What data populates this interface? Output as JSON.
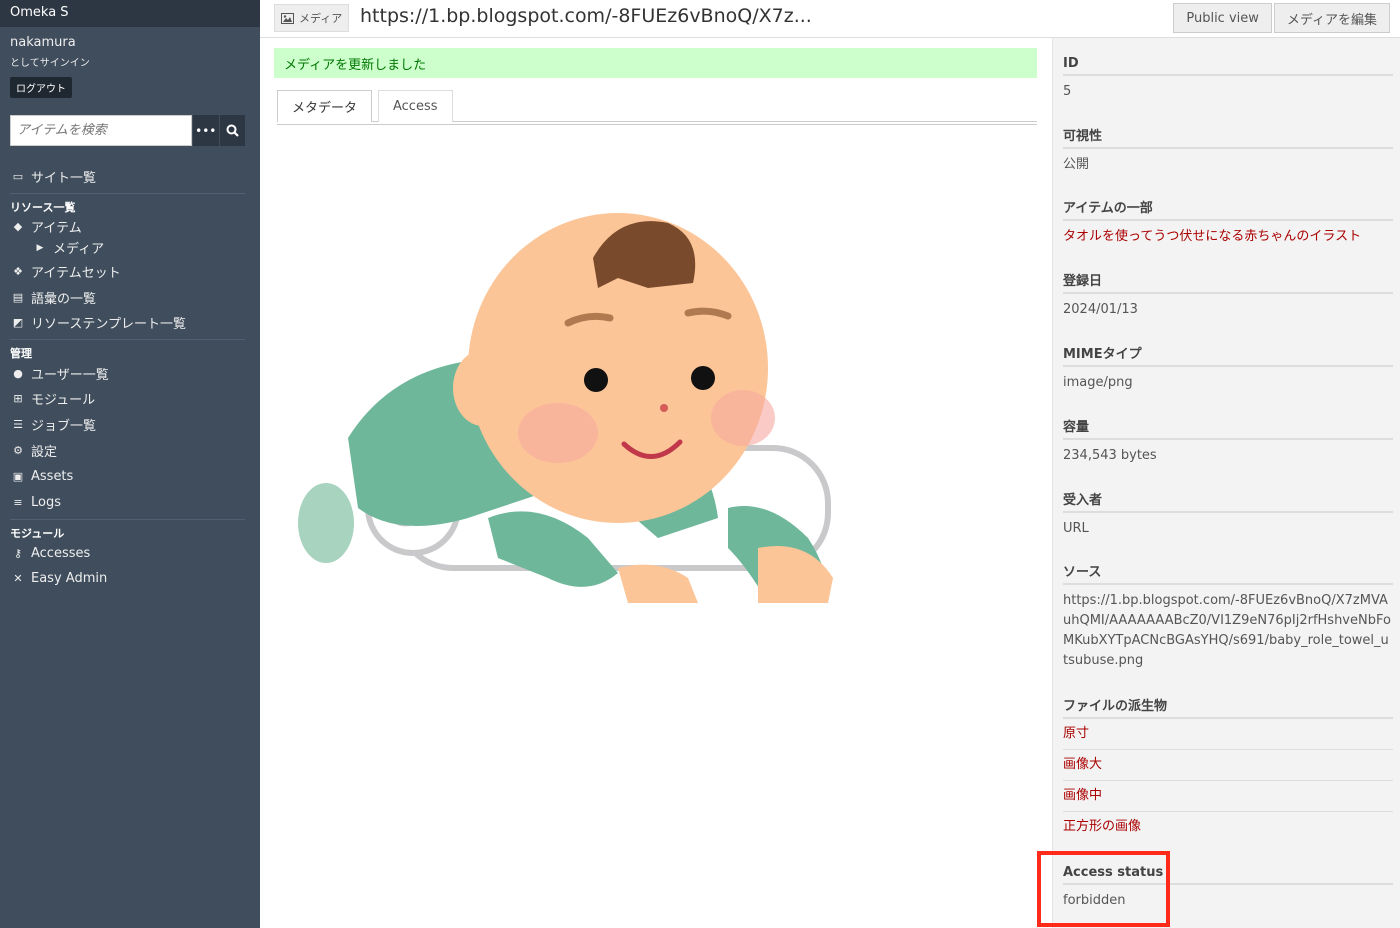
{
  "brand": "Omeka S",
  "user": {
    "name": "nakamura",
    "signed_in_as": "としてサインイン",
    "logout": "ログアウト"
  },
  "search": {
    "placeholder": "アイテムを検索",
    "more_icon": "ellipsis-icon",
    "submit_icon": "search-icon"
  },
  "nav": {
    "sites": "サイト一覧",
    "resources_header": "リソース一覧",
    "items": "アイテム",
    "media": "メディア",
    "item_sets": "アイテムセット",
    "vocabularies": "語彙の一覧",
    "resource_templates": "リソーステンプレート一覧",
    "admin_header": "管理",
    "users": "ユーザー一覧",
    "modules": "モジュール",
    "jobs": "ジョブ一覧",
    "settings": "設定",
    "assets": "Assets",
    "logs": "Logs",
    "modules_header": "モジュール",
    "accesses": "Accesses",
    "easy_admin": "Easy Admin"
  },
  "header": {
    "type_label": "メディア",
    "title": "https://1.bp.blogspot.com/-8FUEz6vBnoQ/X7z...",
    "public_view": "Public view",
    "edit_media": "メディアを編集"
  },
  "flash": "メディアを更新しました",
  "tabs": {
    "metadata": "メタデータ",
    "access": "Access"
  },
  "meta": {
    "id_label": "ID",
    "id_value": "5",
    "visibility_label": "可視性",
    "visibility_value": "公開",
    "part_of_label": "アイテムの一部",
    "part_of_value": "タオルを使ってうつ伏せになる赤ちゃんのイラスト",
    "created_label": "登録日",
    "created_value": "2024/01/13",
    "mime_label": "MIMEタイプ",
    "mime_value": "image/png",
    "size_label": "容量",
    "size_value": "234,543 bytes",
    "ingester_label": "受入者",
    "ingester_value": "URL",
    "source_label": "ソース",
    "source_value": "https://1.bp.blogspot.com/-8FUEz6vBnoQ/X7zMVAuhQMI/AAAAAAABcZ0/VI1Z9eN76pIj2rfHshveNbFoMKubXYTpACNcBGAsYHQ/s691/baby_role_towel_utsubuse.png",
    "derivatives_label": "ファイルの派生物",
    "deriv_original": "原寸",
    "deriv_large": "画像大",
    "deriv_medium": "画像中",
    "deriv_square": "正方形の画像",
    "access_status_label": "Access status",
    "access_status_value": "forbidden"
  },
  "colors": {
    "sidebar_bg": "#3f4d5c",
    "flash_bg": "#ccffcc",
    "link": "#aa0000",
    "highlight": "#ff2a1a"
  }
}
